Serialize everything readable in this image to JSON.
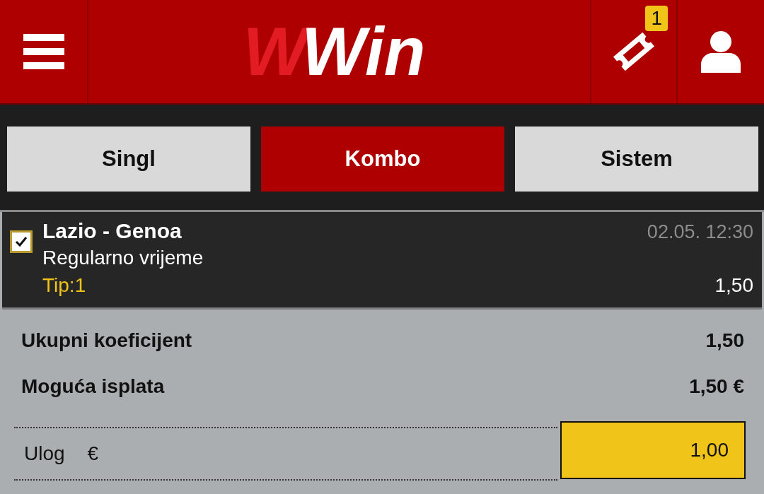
{
  "header": {
    "logo": [
      {
        "text": "W",
        "color": "#e31b23"
      },
      {
        "text": "Win",
        "color": "#ffffff"
      }
    ],
    "ticket_badge": "1"
  },
  "tabs": [
    {
      "label": "Singl",
      "selected": false
    },
    {
      "label": "Kombo",
      "selected": true
    },
    {
      "label": "Sistem",
      "selected": false
    }
  ],
  "bets": [
    {
      "checked": true,
      "match": "Lazio - Genoa",
      "datetime": "02.05. 12:30",
      "market": "Regularno vrijeme",
      "tip": "Tip:1",
      "odds": "1,50"
    }
  ],
  "summary": [
    {
      "label": "Ukupni koeficijent",
      "value": "1,50"
    },
    {
      "label": "Moguća isplata",
      "value": "1,50 €"
    }
  ],
  "stake": {
    "label": "Ulog",
    "currency": "€",
    "value": "1,00"
  }
}
